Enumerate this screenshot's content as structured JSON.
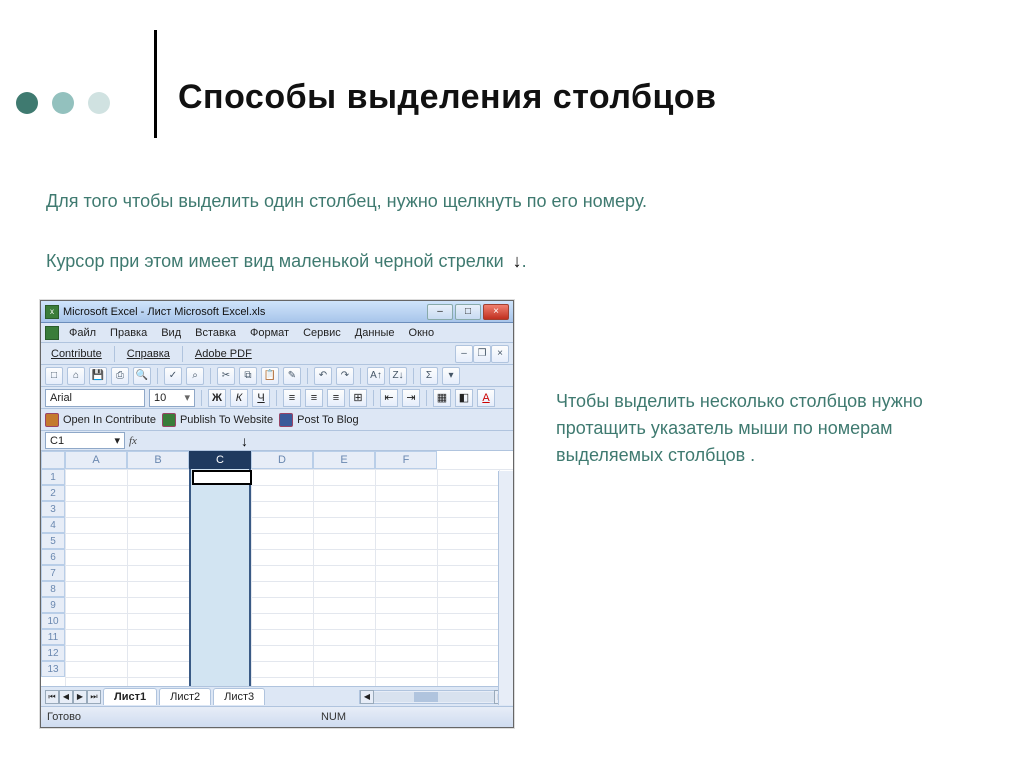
{
  "slide": {
    "title": "Способы выделения столбцов",
    "para1": "Для того чтобы выделить один столбец, нужно щелкнуть по его номеру.",
    "para2": "Курсор при этом имеет вид маленькой черной стрелки",
    "side": "Чтобы выделить несколько столбцов нужно протащить указатель мыши по номерам выделяемых столбцов .",
    "arrow_glyph": "↓"
  },
  "excel": {
    "title": "Microsoft Excel - Лист Microsoft Excel.xls",
    "menu": [
      "Файл",
      "Правка",
      "Вид",
      "Вставка",
      "Формат",
      "Сервис",
      "Данные",
      "Окно"
    ],
    "toolbar2": {
      "contribute": "Contribute",
      "help": "Справка",
      "adobe": "Adobe PDF"
    },
    "font": {
      "name": "Arial",
      "size": "10"
    },
    "format_buttons": {
      "bold": "Ж",
      "italic": "К",
      "underline": "Ч",
      "fontcolor": "A"
    },
    "publish": {
      "open": "Open In Contribute",
      "pub": "Publish To Website",
      "post": "Post To Blog"
    },
    "namebox": "C1",
    "fx": "fx",
    "columns": [
      "A",
      "B",
      "C",
      "D",
      "E",
      "F"
    ],
    "rows": [
      "1",
      "2",
      "3",
      "4",
      "5",
      "6",
      "7",
      "8",
      "9",
      "10",
      "11",
      "12",
      "13"
    ],
    "selected_col": "C",
    "sheets": {
      "s1": "Лист1",
      "s2": "Лист2",
      "s3": "Лист3"
    },
    "status": {
      "ready": "Готово",
      "num": "NUM"
    }
  }
}
